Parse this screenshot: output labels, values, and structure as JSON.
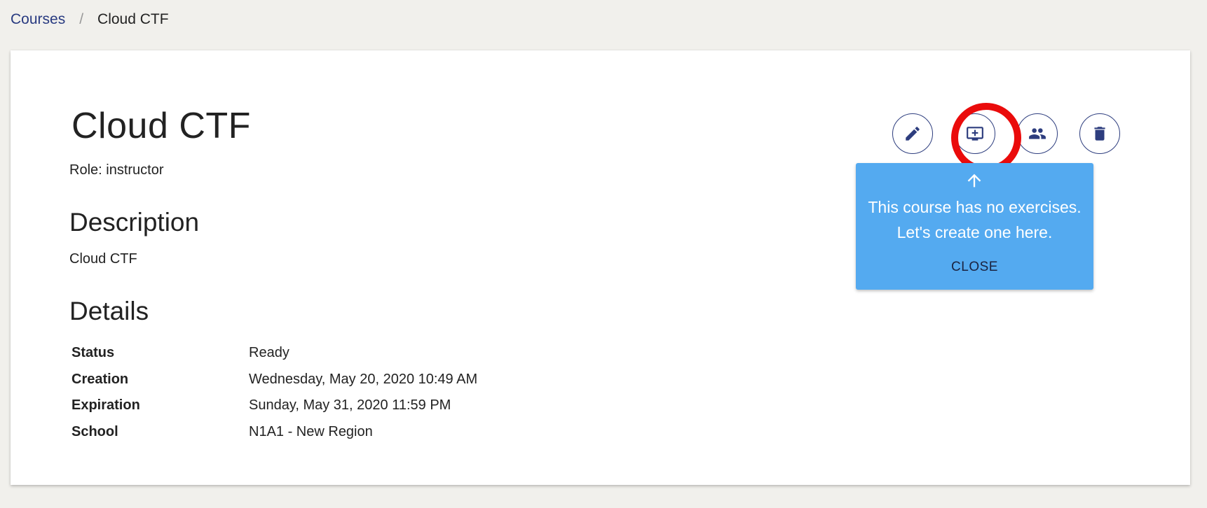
{
  "breadcrumb": {
    "courses_label": "Courses",
    "separator": "/",
    "current": "Cloud CTF"
  },
  "course": {
    "title": "Cloud CTF",
    "role": "Role: instructor",
    "description_heading": "Description",
    "description": "Cloud CTF",
    "details_heading": "Details",
    "details": [
      {
        "label": "Status",
        "value": "Ready"
      },
      {
        "label": "Creation",
        "value": "Wednesday, May 20, 2020 10:49 AM"
      },
      {
        "label": "Expiration",
        "value": "Sunday, May 31, 2020 11:59 PM"
      },
      {
        "label": "School",
        "value": "N1A1 - New Region"
      }
    ]
  },
  "actions": [
    {
      "name": "edit",
      "icon": "pencil-icon"
    },
    {
      "name": "add-exercise",
      "icon": "monitor-plus-icon"
    },
    {
      "name": "students",
      "icon": "people-icon"
    },
    {
      "name": "delete",
      "icon": "trash-icon"
    }
  ],
  "tooltip": {
    "line1": "This course has no exercises.",
    "line2": "Let's create one here.",
    "close_label": "CLOSE",
    "icon": "arrow-up-icon"
  },
  "colors": {
    "background": "#f1f0ec",
    "accent_navy": "#2d3d7e",
    "link": "#283a80",
    "tooltip_bg": "#54aaf0",
    "highlight_ring": "#ea0b0b"
  }
}
